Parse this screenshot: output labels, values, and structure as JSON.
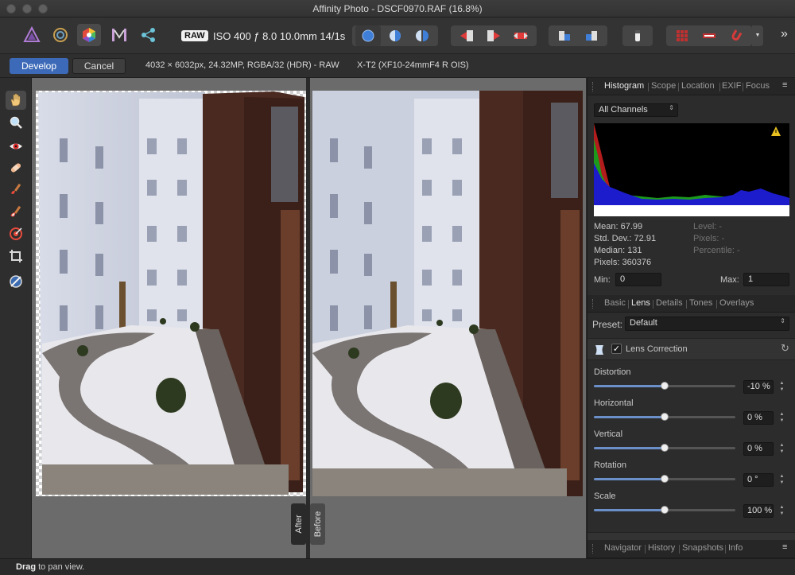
{
  "window": {
    "title": "Affinity Photo - DSCF0970.RAF (16.8%)"
  },
  "toolbar": {
    "raw_badge": "RAW",
    "exif_summary": "ISO 400 ƒ 8.0 10.0mm 14/1s",
    "more_label": "»"
  },
  "context": {
    "develop_label": "Develop",
    "cancel_label": "Cancel",
    "image_info": "4032 × 6032px, 24.32MP, RGBA/32 (HDR) - RAW",
    "camera_info": "X-T2 (XF10-24mmF4 R OIS)"
  },
  "view": {
    "after_label": "After",
    "before_label": "Before"
  },
  "status": {
    "bold": "Drag",
    "text": " to pan view."
  },
  "panel_top": {
    "tabs": [
      "Histogram",
      "Scope",
      "Location",
      "EXIF",
      "Focus"
    ],
    "active_tab": 0
  },
  "histogram": {
    "channel": "All Channels",
    "mean": "Mean: 67.99",
    "std_dev": "Std. Dev.: 72.91",
    "median": "Median: 131",
    "pixels": "Pixels: 360376",
    "level": "Level: -",
    "pixels_sel": "Pixels: -",
    "percentile": "Percentile: -",
    "min_label": "Min:",
    "min_value": "0",
    "max_label": "Max:",
    "max_value": "1"
  },
  "panel_mid": {
    "tabs": [
      "Basic",
      "Lens",
      "Details",
      "Tones",
      "Overlays"
    ],
    "active_tab": 1
  },
  "lens": {
    "preset_label": "Preset:",
    "preset_value": "Default",
    "section_title": "Lens Correction",
    "enabled": true,
    "sliders": [
      {
        "label": "Distortion",
        "value_text": "-10 %",
        "fraction": 0.5
      },
      {
        "label": "Horizontal",
        "value_text": "0 %",
        "fraction": 0.5
      },
      {
        "label": "Vertical",
        "value_text": "0 %",
        "fraction": 0.5
      },
      {
        "label": "Rotation",
        "value_text": "0 °",
        "fraction": 0.5
      },
      {
        "label": "Scale",
        "value_text": "100 %",
        "fraction": 0.5
      }
    ]
  },
  "panel_bottom": {
    "tabs": [
      "Navigator",
      "History",
      "Snapshots",
      "Info"
    ]
  },
  "colors": {
    "accent": "#3d6ab8",
    "slider": "#6a8fc9"
  }
}
